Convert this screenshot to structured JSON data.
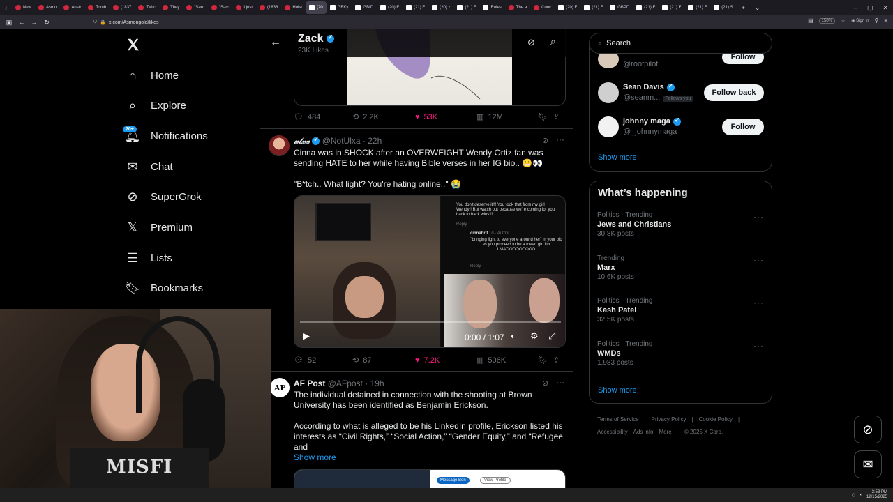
{
  "browser": {
    "tabs": [
      "New",
      "Asmo",
      "Austr",
      "Tomb",
      "(1837",
      "Twitc",
      "They",
      "\"Sarc",
      "\"Sarc",
      "I just",
      "(1838",
      "Hoist",
      "(20",
      "GBKy",
      "GBID",
      "(20) F",
      "(21) F",
      "(20) z",
      "(21) F",
      "Rules",
      "The a",
      "Conc",
      "(20) F",
      "(21) F",
      "GBPD",
      "(21) F",
      "(21) F",
      "(21) F",
      "(21) S"
    ],
    "active_tab_index": 12,
    "url": "x.com/Asmongold/likes",
    "zoom": "150%",
    "sign_in": "Sign in"
  },
  "left_nav": {
    "items": [
      {
        "label": "Home",
        "icon": "home-icon"
      },
      {
        "label": "Explore",
        "icon": "search-icon"
      },
      {
        "label": "Notifications",
        "icon": "bell-icon"
      },
      {
        "label": "Chat",
        "icon": "mail-icon"
      },
      {
        "label": "SuperGrok",
        "icon": "grok-icon"
      },
      {
        "label": "Premium",
        "icon": "x-logo-icon"
      },
      {
        "label": "Lists",
        "icon": "list-icon"
      },
      {
        "label": "Bookmarks",
        "icon": "bookmark-icon"
      }
    ],
    "notifications_badge": "20+"
  },
  "header": {
    "name": "Zack",
    "subtitle": "23K Likes"
  },
  "tweet1_actions": {
    "replies": "484",
    "reposts": "2.2K",
    "likes": "53K",
    "views": "12M"
  },
  "tweet2": {
    "name": "𝓊𝓁𝓍𝒶",
    "handle": "@NotUlxa",
    "time": "22h",
    "text1": "Cinna was in SHOCK after an OVERWEIGHT Wendy Ortiz fan was sending HATE to her while having Bible verses in her IG bio.. 😬👀",
    "text2": "\"B*tch.. What light? You're hating online..\" 😭",
    "video_time": "0:00 / 1:07",
    "comment1": "You don't deserve it!!! You took that from my girl Wendy!! But watch out because we're coming for you back to back wins!!!",
    "reply_label": "Reply",
    "comment2_author": "cinnabrit",
    "comment2_meta": "1d · Author",
    "comment2": "\"bringing light to everyone around her\" in your bio as you proceed to be a mean girl I'm LMAOOOOOOOOO",
    "replies": "52",
    "reposts": "87",
    "likes": "7.2K",
    "views": "506K"
  },
  "tweet3": {
    "name": "AF Post",
    "handle": "@AFpost",
    "time": "19h",
    "text1": "The individual detained in connection with the shooting at Brown University has been identified as Benjamin Erickson.",
    "text2": "According to what is alleged to be his LinkedIn profile, Erickson listed his interests as “Civil Rights,” “Social Action,” “Gender Equity,” and “Refugee and",
    "show_more": "Show more",
    "linkedin_message": "Message Ben",
    "linkedin_profile": "View Profile"
  },
  "right": {
    "search_placeholder": "Search",
    "who_to_follow": [
      {
        "name": "",
        "handle": "@rootpilot",
        "button": "Follow",
        "follows_you": ""
      },
      {
        "name": "Sean Davis",
        "handle": "@seanm...",
        "button": "Follow back",
        "follows_you": "Follows you"
      },
      {
        "name": "johnny maga",
        "handle": "@_johnnymaga",
        "button": "Follow",
        "follows_you": ""
      }
    ],
    "show_more": "Show more",
    "happening_title": "What’s happening",
    "trends": [
      {
        "category": "Politics · Trending",
        "title": "Jews and Christians",
        "count": "30.8K posts"
      },
      {
        "category": "Trending",
        "title": "Marx",
        "count": "10.6K posts"
      },
      {
        "category": "Politics · Trending",
        "title": "Kash Patel",
        "count": "32.5K posts"
      },
      {
        "category": "Politics · Trending",
        "title": "WMDs",
        "count": "1,983 posts"
      }
    ],
    "trends_show_more": "Show more",
    "footer_row1": [
      "Terms of Service",
      "Privacy Policy",
      "Cookie Policy"
    ],
    "footer_row2": [
      "Accessibility",
      "Ads info",
      "More ···",
      "© 2025 X Corp."
    ]
  },
  "taskbar": {
    "time": "3:53 PM",
    "date": "12/15/2025"
  },
  "webcam": {
    "shirt_text": "MISFI"
  },
  "colors": {
    "accent": "#1d9bf0",
    "like": "#f91880",
    "muted": "#71767b",
    "border": "#2f3336"
  }
}
